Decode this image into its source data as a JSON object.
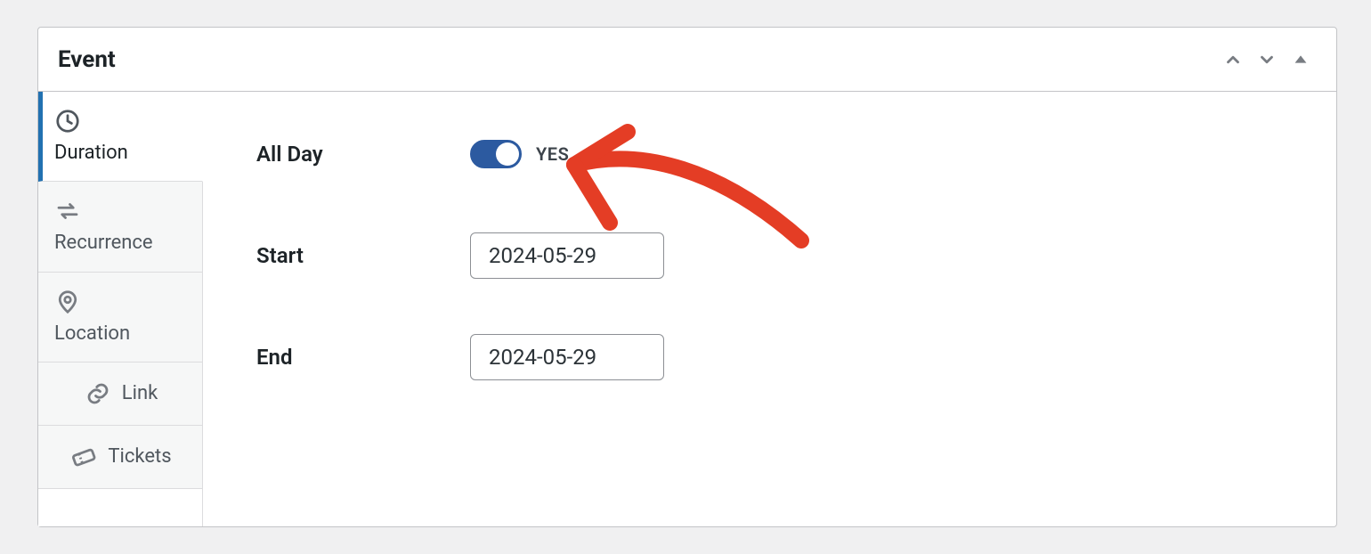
{
  "panel": {
    "title": "Event"
  },
  "tabs": {
    "duration": "Duration",
    "recurrence": "Recurrence",
    "location": "Location",
    "link": "Link",
    "tickets": "Tickets"
  },
  "fields": {
    "allDay": {
      "label": "All Day",
      "value": "YES"
    },
    "start": {
      "label": "Start",
      "value": "2024-05-29"
    },
    "end": {
      "label": "End",
      "value": "2024-05-29"
    }
  },
  "colors": {
    "accent": "#2271b1",
    "annotation": "#e43d25"
  }
}
